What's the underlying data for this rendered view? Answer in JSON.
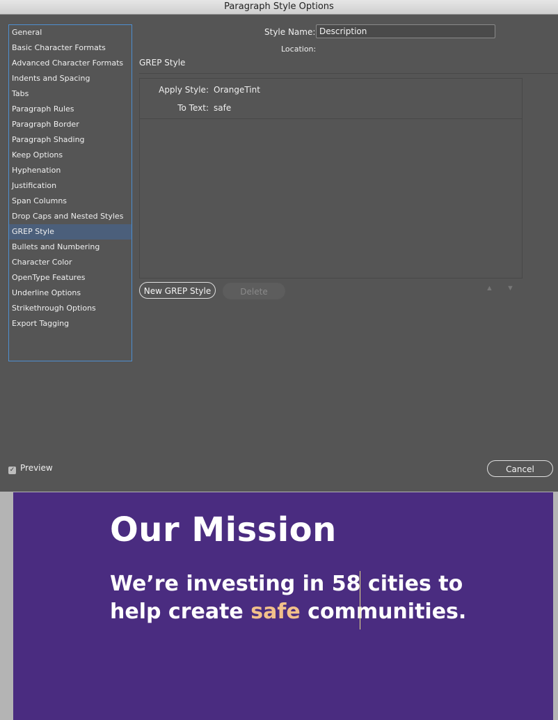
{
  "window": {
    "title": "Paragraph Style Options"
  },
  "categories": [
    "General",
    "Basic Character Formats",
    "Advanced Character Formats",
    "Indents and Spacing",
    "Tabs",
    "Paragraph Rules",
    "Paragraph Border",
    "Paragraph Shading",
    "Keep Options",
    "Hyphenation",
    "Justification",
    "Span Columns",
    "Drop Caps and Nested Styles",
    "GREP Style",
    "Bullets and Numbering",
    "Character Color",
    "OpenType Features",
    "Underline Options",
    "Strikethrough Options",
    "Export Tagging"
  ],
  "selected_category": "GREP Style",
  "form": {
    "style_name_label": "Style Name:",
    "style_name_value": "Description",
    "location_label": "Location:"
  },
  "grep": {
    "section_title": "GREP Style",
    "apply_style_label": "Apply Style:",
    "apply_style_value": "OrangeTint",
    "to_text_label": "To Text:",
    "to_text_value": "safe",
    "new_button": "New GREP Style",
    "delete_button": "Delete"
  },
  "footer": {
    "preview_label": "Preview",
    "preview_checked": true,
    "cancel_button": "Cancel"
  },
  "document": {
    "heading": "Our Mission",
    "body_before": "We’re investing in 58 cities to help create ",
    "body_highlight": "safe",
    "body_after": " communities.",
    "highlight_color": "#f2c08a",
    "background_color": "#4a2c80"
  }
}
